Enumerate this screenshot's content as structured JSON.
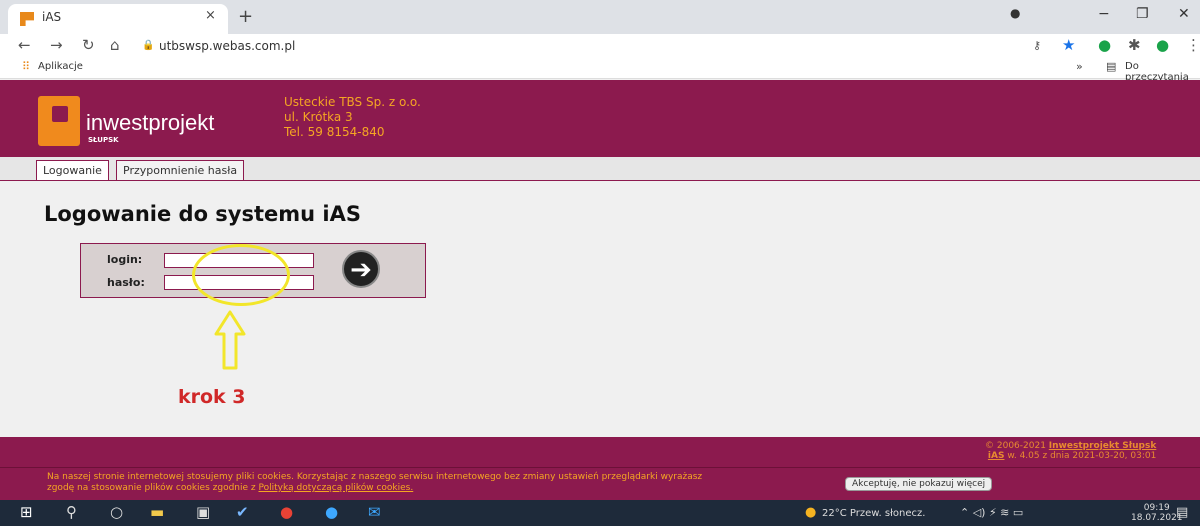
{
  "browser": {
    "tab_title": "iAS",
    "tab_close": "×",
    "new_tab": "+",
    "url": "utbswsp.webas.com.pl",
    "apps_label": "Aplikacje",
    "reading_list": "Do przeczytania",
    "window_buttons": {
      "minimize": "−",
      "restore": "❐",
      "close": "✕"
    }
  },
  "header": {
    "logo_text": "inwestprojekt",
    "logo_sub": "SŁUPSK",
    "company_lines": [
      "Usteckie TBS Sp. z o.o.",
      "ul. Krótka 3",
      "Tel. 59 8154-840"
    ]
  },
  "tabs": [
    {
      "label": "Logowanie"
    },
    {
      "label": "Przypomnienie hasła"
    }
  ],
  "login": {
    "title": "Logowanie do systemu iAS",
    "login_label": "login:",
    "password_label": "hasło:",
    "annotation": "krok 3"
  },
  "footer": {
    "copyright_prefix": "© 2006-2021",
    "copyright_link": "Inwestprojekt Słupsk",
    "version_app": "iAS",
    "version_text": "w. 4.05 z dnia 2021-03-20, 03:01"
  },
  "cookie": {
    "text_line1": "Na naszej stronie internetowej stosujemy pliki cookies. Korzystając z naszego serwisu internetowego bez zmiany ustawień przeglądarki wyrażasz",
    "text_line2": "zgodę na stosowanie plików cookies zgodnie z",
    "link": "Polityką dotyczącą plików cookies.",
    "button": "Akceptuję, nie pokazuj więcej"
  },
  "taskbar": {
    "weather": "22°C Przew. słonecz.",
    "time": "09:19",
    "date": "18.07.2021"
  },
  "colors": {
    "brand": "#8c1a4e",
    "accent": "#f5a623",
    "highlight": "#f2e62a",
    "annotation": "#d02828"
  }
}
